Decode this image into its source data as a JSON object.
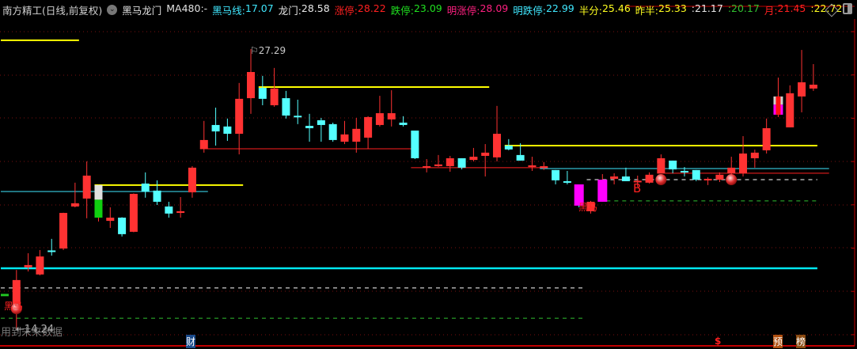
{
  "header": {
    "title": "南方精工(日线,前复权)",
    "indicator_name": "黑马龙门",
    "items": [
      {
        "label": "MA480: ",
        "value": "-",
        "color": "#e0e0e0"
      },
      {
        "label": "黑马线: ",
        "value": "17.07",
        "color": "#40e8ff"
      },
      {
        "label": "龙门: ",
        "value": "28.58",
        "color": "#e8e8e8"
      },
      {
        "label": "涨停: ",
        "value": "28.22",
        "color": "#ff2020"
      },
      {
        "label": "跌停: ",
        "value": "23.09",
        "color": "#20e020"
      },
      {
        "label": "明涨停: ",
        "value": "28.09",
        "color": "#ff2080"
      },
      {
        "label": "明跌停: ",
        "value": "22.99",
        "color": "#40e8ff"
      },
      {
        "label": "半分: ",
        "value": "25.46",
        "color": "#ffff20"
      },
      {
        "label": "昨半: ",
        "value": "25.33",
        "color": "#ffff20"
      },
      {
        "label": ": ",
        "value": "21.17",
        "color": "#e8e8e8"
      },
      {
        "label": ": ",
        "value": "20.17",
        "color": "#30c030"
      },
      {
        "label": "月: ",
        "value": "21.45",
        "color": "#ff2020"
      },
      {
        "label": ": ",
        "value": "22.72",
        "color": "#ffff20"
      }
    ],
    "icons": [
      "dropdown-icon",
      "diamond-icon",
      "panel-toggle-icon"
    ]
  },
  "annotations": {
    "high_label": "27.29",
    "low_label": "←14.24",
    "future_data_warning": "用到未来数据",
    "heima_label": "黑马",
    "buy_label": "B",
    "bottom_markers": [
      {
        "text": "财",
        "bg": "#1a4a8a",
        "color": "#ffffff"
      },
      {
        "text": "$",
        "bg": "transparent",
        "color": "#ff2020"
      },
      {
        "text": "预",
        "bg": "#b05010",
        "color": "#ffffff"
      },
      {
        "text": "榜",
        "bg": "#8a4a10",
        "color": "#ffffff"
      }
    ]
  },
  "colors": {
    "up": "#ff3232",
    "down": "#54ffff",
    "magenta": "#ff00ff",
    "grid": "#7a1010",
    "axis": "#c00000"
  },
  "chart_data": {
    "type": "candlestick",
    "candles": [
      {
        "o": 15.82,
        "c": 15.84,
        "h": 15.86,
        "l": 15.78,
        "kind": "green"
      },
      {
        "o": 15.0,
        "c": 16.52,
        "h": 16.99,
        "l": 14.24
      },
      {
        "o": 17.11,
        "c": 17.22,
        "h": 17.77,
        "l": 16.92
      },
      {
        "o": 16.78,
        "c": 17.62,
        "h": 17.92,
        "l": 16.74
      },
      {
        "o": 17.9,
        "c": 17.86,
        "h": 18.44,
        "l": 17.66
      },
      {
        "o": 17.99,
        "c": 19.65,
        "h": 19.66,
        "l": 17.92
      },
      {
        "o": 19.95,
        "c": 20.1,
        "h": 21.06,
        "l": 19.91
      },
      {
        "o": 20.32,
        "c": 21.39,
        "h": 22.05,
        "l": 19.4
      },
      {
        "o": 19.43,
        "c": 20.95,
        "h": 20.95,
        "l": 19.25,
        "kind": "green-white"
      },
      {
        "o": 19.28,
        "c": 19.43,
        "h": 19.91,
        "l": 18.95
      },
      {
        "o": 19.43,
        "c": 18.66,
        "h": 19.45,
        "l": 18.55
      },
      {
        "o": 18.77,
        "c": 20.54,
        "h": 20.56,
        "l": 18.75
      },
      {
        "o": 21.02,
        "c": 20.65,
        "h": 21.54,
        "l": 20.36
      },
      {
        "o": 20.69,
        "c": 20.17,
        "h": 21.17,
        "l": 20.02
      },
      {
        "o": 19.95,
        "c": 19.62,
        "h": 20.17,
        "l": 19.43
      },
      {
        "o": 19.65,
        "c": 19.73,
        "h": 20.39,
        "l": 19.43
      },
      {
        "o": 20.61,
        "c": 21.76,
        "h": 21.83,
        "l": 20.36
      },
      {
        "o": 22.64,
        "c": 23.05,
        "h": 23.94,
        "l": 22.46
      },
      {
        "o": 23.75,
        "c": 23.45,
        "h": 24.56,
        "l": 22.79
      },
      {
        "o": 23.68,
        "c": 23.34,
        "h": 24.05,
        "l": 23.01
      },
      {
        "o": 23.34,
        "c": 24.97,
        "h": 25.71,
        "l": 22.38
      },
      {
        "o": 25.0,
        "c": 26.22,
        "h": 27.29,
        "l": 24.27
      },
      {
        "o": 25.48,
        "c": 24.97,
        "h": 26.04,
        "l": 24.67
      },
      {
        "o": 24.67,
        "c": 25.45,
        "h": 26.41,
        "l": 24.6
      },
      {
        "o": 25.0,
        "c": 24.19,
        "h": 25.34,
        "l": 24.05
      },
      {
        "o": 24.18,
        "c": 24.15,
        "h": 24.93,
        "l": 23.79
      },
      {
        "o": 23.71,
        "c": 23.6,
        "h": 24.27,
        "l": 22.97
      },
      {
        "o": 23.97,
        "c": 23.75,
        "h": 24.08,
        "l": 22.97
      },
      {
        "o": 23.79,
        "c": 23.05,
        "h": 23.86,
        "l": 22.97
      },
      {
        "o": 22.97,
        "c": 23.31,
        "h": 23.94,
        "l": 22.86
      },
      {
        "o": 22.97,
        "c": 23.57,
        "h": 24.08,
        "l": 22.46
      },
      {
        "o": 23.16,
        "c": 24.12,
        "h": 24.16,
        "l": 22.64
      },
      {
        "o": 23.75,
        "c": 24.3,
        "h": 25.11,
        "l": 23.68
      },
      {
        "o": 24.01,
        "c": 24.3,
        "h": 25.37,
        "l": 23.68
      },
      {
        "o": 23.86,
        "c": 23.75,
        "h": 24.16,
        "l": 23.68
      },
      {
        "o": 23.49,
        "c": 22.2,
        "h": 23.49,
        "l": 22.16
      },
      {
        "o": 21.79,
        "c": 21.83,
        "h": 22.16,
        "l": 21.54
      },
      {
        "o": 21.83,
        "c": 21.91,
        "h": 22.35,
        "l": 21.8
      },
      {
        "o": 21.83,
        "c": 22.2,
        "h": 22.31,
        "l": 21.57
      },
      {
        "o": 22.2,
        "c": 21.76,
        "h": 22.2,
        "l": 21.68
      },
      {
        "o": 22.12,
        "c": 22.27,
        "h": 22.68,
        "l": 22.05
      },
      {
        "o": 22.31,
        "c": 22.46,
        "h": 22.86,
        "l": 21.35
      },
      {
        "o": 22.24,
        "c": 23.34,
        "h": 24.64,
        "l": 22.05
      },
      {
        "o": 22.79,
        "c": 22.61,
        "h": 23.09,
        "l": 22.57
      },
      {
        "o": 22.35,
        "c": 22.09,
        "h": 22.9,
        "l": 22.09
      },
      {
        "o": 21.79,
        "c": 21.87,
        "h": 22.27,
        "l": 21.61
      },
      {
        "o": 21.79,
        "c": 21.83,
        "h": 22.02,
        "l": 21.65
      },
      {
        "o": 21.65,
        "c": 21.17,
        "h": 21.65,
        "l": 20.98
      },
      {
        "o": 21.13,
        "c": 21.06,
        "h": 21.61,
        "l": 20.98
      },
      {
        "o": 20.98,
        "c": 19.99,
        "h": 20.98,
        "l": 19.91,
        "kind": "magenta"
      },
      {
        "o": 19.73,
        "c": 20.17,
        "h": 20.21,
        "l": 19.62
      },
      {
        "o": 20.17,
        "c": 21.2,
        "h": 21.46,
        "l": 20.17,
        "kind": "magenta"
      },
      {
        "o": 21.24,
        "c": 21.35,
        "h": 21.5,
        "l": 20.98
      },
      {
        "o": 21.35,
        "c": 21.13,
        "h": 21.76,
        "l": 21.13
      },
      {
        "o": 21.13,
        "c": 21.15,
        "h": 21.39,
        "l": 20.87
      },
      {
        "o": 21.06,
        "c": 21.43,
        "h": 21.54,
        "l": 21.02
      },
      {
        "o": 21.5,
        "c": 22.2,
        "h": 22.38,
        "l": 21.5
      },
      {
        "o": 22.09,
        "c": 21.68,
        "h": 22.09,
        "l": 21.5
      },
      {
        "o": 21.61,
        "c": 21.58,
        "h": 21.79,
        "l": 21.35
      },
      {
        "o": 21.65,
        "c": 21.2,
        "h": 21.65,
        "l": 21.13
      },
      {
        "o": 21.17,
        "c": 21.24,
        "h": 21.31,
        "l": 20.95
      },
      {
        "o": 21.2,
        "c": 21.43,
        "h": 21.54,
        "l": 21.09
      },
      {
        "o": 21.5,
        "c": 21.76,
        "h": 22.27,
        "l": 21.35
      },
      {
        "o": 21.5,
        "c": 22.42,
        "h": 23.23,
        "l": 21.35
      },
      {
        "o": 22.2,
        "c": 22.46,
        "h": 22.6,
        "l": 21.76
      },
      {
        "o": 22.57,
        "c": 23.6,
        "h": 24.05,
        "l": 22.42
      },
      {
        "o": 24.23,
        "c": 25.08,
        "h": 25.96,
        "l": 24.12,
        "kind": "white-magenta"
      },
      {
        "o": 23.64,
        "c": 25.23,
        "h": 25.6,
        "l": 23.64
      },
      {
        "o": 25.08,
        "c": 25.74,
        "h": 27.25,
        "l": 24.34
      },
      {
        "o": 25.45,
        "c": 25.63,
        "h": 26.59,
        "l": 25.34
      }
    ],
    "levels": [
      {
        "price": 27.7,
        "from": 0,
        "to": 6,
        "color": "#ffff00",
        "style": "solid"
      },
      {
        "price": 20.95,
        "from": 8,
        "to": 20,
        "color": "#ffff00",
        "style": "solid"
      },
      {
        "price": 20.65,
        "from": 0,
        "to": 17,
        "color": "#40e8ff",
        "style": "thin"
      },
      {
        "price": 22.64,
        "from": 17,
        "to": 35,
        "color": "#ff2020",
        "style": "thin"
      },
      {
        "price": 25.52,
        "from": 22,
        "to": 41,
        "color": "#ffff00",
        "style": "solid"
      },
      {
        "price": 21.76,
        "from": 35,
        "to": 46,
        "color": "#ff2020",
        "style": "thin"
      },
      {
        "price": 22.79,
        "from": 43,
        "to": 69,
        "color": "#ffff00",
        "style": "solid"
      },
      {
        "price": 21.72,
        "from": 46,
        "to": 70,
        "color": "#40e8ff",
        "style": "thin"
      },
      {
        "price": 21.5,
        "from": 56,
        "to": 70,
        "color": "#ff2020",
        "style": "thin"
      },
      {
        "price": 21.2,
        "from": 50,
        "to": 69,
        "color": "#ffffff",
        "style": "dashed"
      },
      {
        "price": 20.21,
        "from": 51,
        "to": 69,
        "color": "#30c030",
        "style": "dashed"
      },
      {
        "price": 17.07,
        "from": 0,
        "to": 69,
        "color": "#00e8f0",
        "style": "thick"
      },
      {
        "price": 16.15,
        "from": 0,
        "to": 49,
        "color": "#ffffff",
        "style": "dashed"
      },
      {
        "price": 14.74,
        "from": 0,
        "to": 49,
        "color": "#30c030",
        "style": "dashed"
      }
    ],
    "signals": [
      {
        "index": 1,
        "type": "ball"
      },
      {
        "index": 56,
        "type": "ball"
      },
      {
        "index": 62,
        "type": "ball"
      }
    ],
    "high": {
      "index": 21,
      "price": 27.29
    },
    "low": {
      "price": 14.24
    }
  }
}
